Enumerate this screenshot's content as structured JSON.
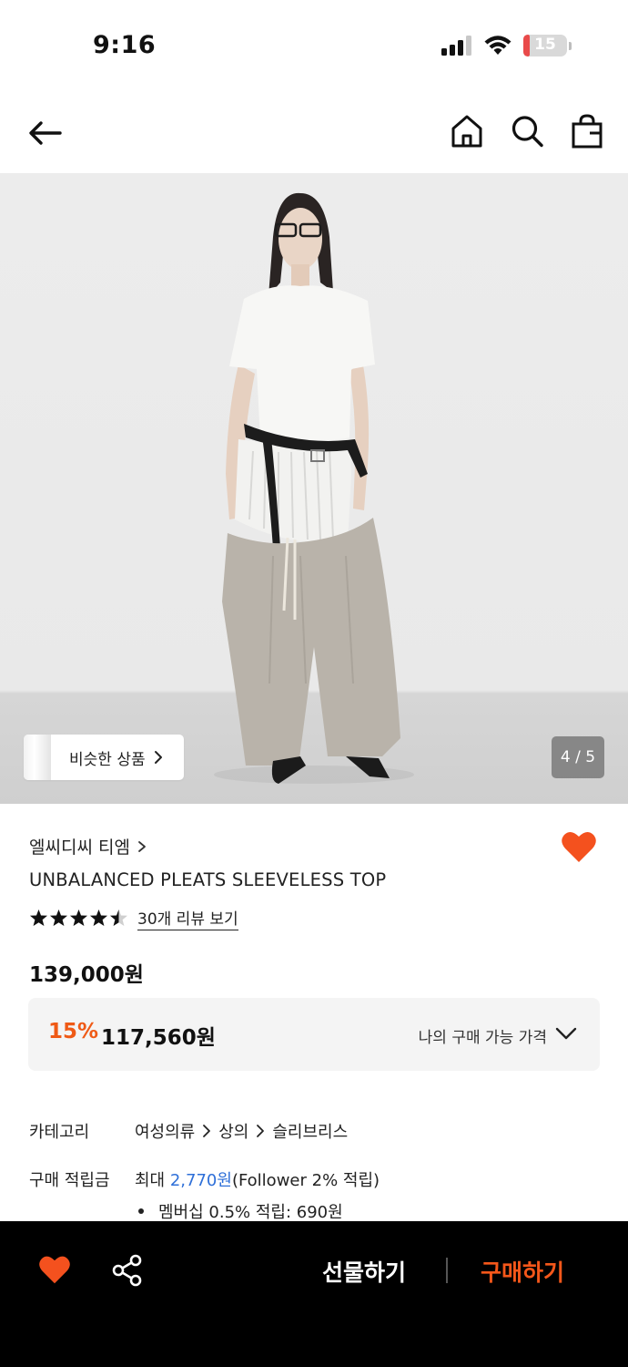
{
  "status_bar": {
    "time": "9:16",
    "battery": "15",
    "battery_level": 0.15,
    "icons": [
      "signal-icon",
      "wifi-icon",
      "battery-icon"
    ]
  },
  "nav": {
    "icons": [
      "back-arrow-icon",
      "home-icon",
      "search-icon",
      "shopping-bag-icon"
    ]
  },
  "hero": {
    "similar_label": "비슷한 상품",
    "page_indicator": "4 / 5"
  },
  "product": {
    "brand": "엘씨디씨 티엠",
    "name": "UNBALANCED PLEATS SLEEVELESS TOP",
    "rating": 4.5,
    "review_link": "30개 리뷰 보기",
    "price": "139,000원",
    "discount_rate": "15%",
    "discount_price": "117,560원",
    "my_price_label": "나의 구매 가능 가격",
    "favorited": true
  },
  "info": {
    "category_label": "카테고리",
    "category_path": [
      "여성의류",
      "상의",
      "슬리브리스"
    ],
    "points_label": "구매 적립금",
    "points_prefix": "최대 ",
    "points_amount": "2,770원",
    "points_suffix": "(Follower 2% 적립)",
    "membership_note": "멤버십 0.5% 적립: 690원"
  },
  "bottom_bar": {
    "gift_label": "선물하기",
    "buy_label": "구매하기"
  },
  "colors": {
    "accent": "#f5571a",
    "discount": "#ef5a16",
    "link_blue": "#2e6fd8",
    "heart": "#f4511e"
  }
}
